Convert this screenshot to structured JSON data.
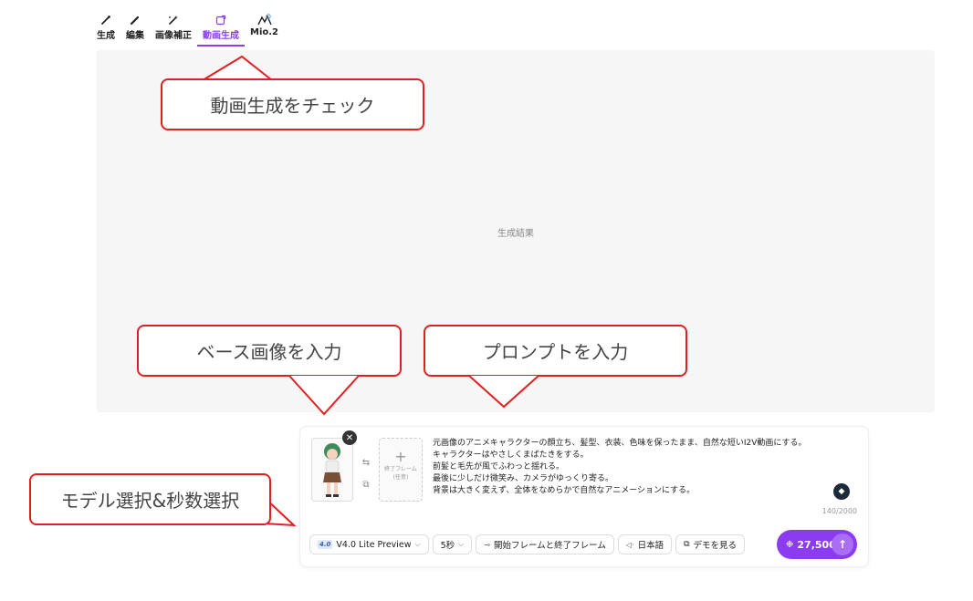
{
  "nav": {
    "items": [
      {
        "label": "生成",
        "icon": "brush-icon"
      },
      {
        "label": "編集",
        "icon": "pencil-icon"
      },
      {
        "label": "画像補正",
        "icon": "magic-wand-icon"
      },
      {
        "label": "動画生成",
        "icon": "video-export-icon",
        "active": true
      },
      {
        "label": "Mio.2",
        "icon": "mio-icon"
      }
    ]
  },
  "result": {
    "label": "生成結果"
  },
  "callouts": {
    "video": "動画生成をチェック",
    "base_image": "ベース画像を入力",
    "prompt": "プロンプトを入力",
    "model": "モデル選択&秒数選択"
  },
  "composer": {
    "end_frame": {
      "line1": "終了フレーム",
      "line2": "(任意)"
    },
    "prompt_lines": [
      "元画像のアニメキャラクターの顔立ち、髪型、衣装、色味を保ったまま、自然な短いI2V動画にする。",
      "キャラクターはやさしくまばたきをする。",
      "前髪と毛先が風でふわっと揺れる。",
      "最後に少しだけ微笑み、カメラがゆっくり寄る。",
      "背景は大きく変えず、全体をなめらかで自然なアニメーションにする。"
    ],
    "char_count": "140/2000",
    "toolbar": {
      "model_badge": "4.0",
      "model": "V4.0 Lite Preview",
      "duration": "5秒",
      "frames": "開始フレームと終了フレーム",
      "language": "日本語",
      "demo": "デモを見る"
    },
    "credits": "27,500"
  },
  "colors": {
    "accent": "#8b3cf0",
    "callout_border": "#e02020"
  }
}
